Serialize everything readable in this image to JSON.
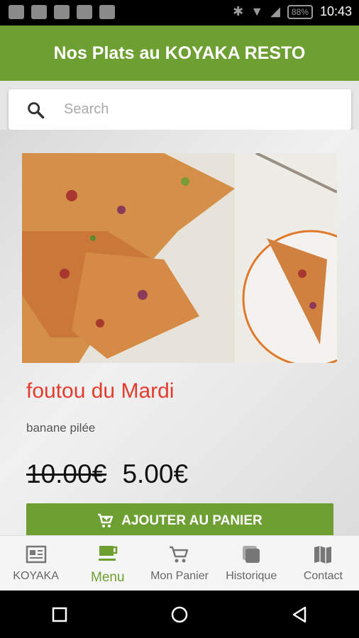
{
  "status_bar": {
    "battery": "88%",
    "time": "10:43"
  },
  "appbar": {
    "title": "Nos Plats au KOYAKA RESTO"
  },
  "search": {
    "placeholder": "Search"
  },
  "product": {
    "image_icon": "pizza-photo",
    "title": "foutou du Mardi",
    "description": "banane pilée",
    "old_price": "10.00€",
    "price": "5.00€",
    "add_to_cart": "AJOUTER AU PANIER"
  },
  "bottom_nav": {
    "items": [
      {
        "label": "KOYAKA",
        "icon": "newspaper-icon"
      },
      {
        "label": "Menu",
        "icon": "coffee-icon",
        "active": true
      },
      {
        "label": "Mon Panier",
        "icon": "cart-icon"
      },
      {
        "label": "Historique",
        "icon": "history-icon"
      },
      {
        "label": "Contact",
        "icon": "map-icon"
      }
    ]
  },
  "colors": {
    "accent": "#6e9f32",
    "title_red": "#e53b2c"
  }
}
